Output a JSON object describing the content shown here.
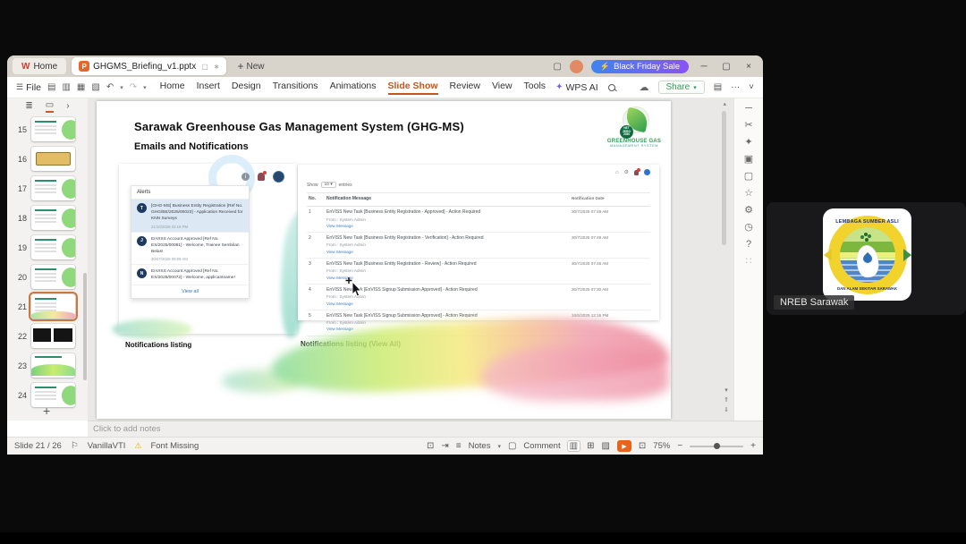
{
  "titlebar": {
    "home_tab": "Home",
    "doc_tab": "GHGMS_Briefing_v1.pptx",
    "new_label": "New",
    "promo_label": "Black Friday Sale"
  },
  "menubar": {
    "file_label": "File",
    "items": [
      "Home",
      "Insert",
      "Design",
      "Transitions",
      "Animations",
      "Slide Show",
      "Review",
      "View",
      "Tools"
    ],
    "active_item": "Slide Show",
    "wps_ai_label": "WPS AI",
    "share_label": "Share"
  },
  "thumbnails": {
    "slides": [
      {
        "num": "15",
        "variant": "green"
      },
      {
        "num": "16",
        "variant": "yellow"
      },
      {
        "num": "17",
        "variant": "green"
      },
      {
        "num": "18",
        "variant": "green"
      },
      {
        "num": "19",
        "variant": "green"
      },
      {
        "num": "20",
        "variant": "green"
      },
      {
        "num": "21",
        "variant": "pink",
        "selected": true
      },
      {
        "num": "22",
        "variant": "dark"
      },
      {
        "num": "23",
        "variant": "green2"
      },
      {
        "num": "24",
        "variant": "green"
      }
    ]
  },
  "slide": {
    "title": "Sarawak Greenhouse Gas Management System (GHG-MS)",
    "subtitle": "Emails and Notifications",
    "logo": {
      "badge_line1": "NET",
      "badge_line2": "ZERO",
      "badge_line3": "2050",
      "name_line1": "GREENHOUSE GAS",
      "name_line2": "MANAGEMENT SYSTEM"
    },
    "captions": {
      "left": "Notifications listing",
      "right": "Notifications listing (View All)"
    },
    "alerts": {
      "header": "Alerts",
      "view_all": "View all",
      "items": [
        {
          "avatar": "T",
          "text": "[GHG-MS] Business Entity Registration [Ref No. GHG/BE/2025/00023] - Application Received for KNN Surveys",
          "time": "21/10/2025 02:19 PM",
          "highlight": true
        },
        {
          "avatar": "J",
          "text": "EnVISS Account Approved [Ref No. ES/2025/00081] - Welcome, Trainee Sembilan Belas!",
          "time": "30/07/2025 09:09 AM",
          "highlight": false
        },
        {
          "avatar": "N",
          "text": "EnVISS Account Approved [Ref No. ES/2025/00072] - Welcome, applicantname!",
          "time": "",
          "highlight": false
        }
      ]
    },
    "portal": {
      "show_label": "Show",
      "show_value": "10",
      "entries_label": "entries",
      "headers": [
        "No.",
        "Notification Message",
        "Notification Date"
      ],
      "rows": [
        {
          "no": "1",
          "message": "EnVISS New Task [Business Entity Registration - Approved] - Action Required",
          "from": "From : System Admin",
          "link": "View Message",
          "date": "30/7/2025 07:49 AM"
        },
        {
          "no": "2",
          "message": "EnVISS New Task [Business Entity Registration - Verification] - Action Required",
          "from": "From : System Admin",
          "link": "View Message",
          "date": "30/7/2025 07:49 AM"
        },
        {
          "no": "3",
          "message": "EnVISS New Task [Business Entity Registration - Review] - Action Required",
          "from": "From : System Admin",
          "link": "View Message",
          "date": "30/7/2025 07:46 AM"
        },
        {
          "no": "4",
          "message": "EnVISS New Task [EnVISS Signup Submission Approved] - Action Required",
          "from": "From : System Admin",
          "link": "View Message",
          "date": "30/7/2025 07:30 AM"
        },
        {
          "no": "5",
          "message": "EnVISS New Task [EnVISS Signup Submission Approved] - Action Required",
          "from": "From : System Admin",
          "link": "View Message",
          "date": "16/6/2025 12:16 PM"
        }
      ]
    }
  },
  "notes_placeholder": "Click to add notes",
  "statusbar": {
    "slide_info": "Slide 21 / 26",
    "theme_name": "VanillaVTI",
    "font_warning": "Font Missing",
    "notes_label": "Notes",
    "comment_label": "Comment",
    "zoom_value": "75%"
  },
  "meeting": {
    "participant_name": "NREB Sarawak",
    "logo_text_top": "LEMBAGA SUMBER ASLI",
    "logo_text_bottom": "DAN ALAM SEKITAR SARAWAK"
  },
  "icons": {
    "hamburger": "☰",
    "save": "▤",
    "export": "▥",
    "print": "▦",
    "print_preview": "▧",
    "undo": "↶",
    "redo": "↷",
    "caret_down": "▾",
    "wps_ai": "✦",
    "cloud": "☁",
    "more": "···",
    "collapse": "˅",
    "split": "▢",
    "minimize": "─",
    "restore": "▢",
    "close": "×",
    "bolt": "⚡",
    "plus": "+",
    "outline_view": "≣",
    "slide_view": "▭",
    "chevron_right": "›",
    "scroll_up": "▴",
    "scroll_down": "▾",
    "prev_slide": "⇑",
    "next_slide": "⇓",
    "home": "⌂",
    "gear": "⚙",
    "bell": "🔔",
    "star": "☆",
    "scissors": "✂",
    "comment_bubble": "▢",
    "clock": "◷",
    "help": "?",
    "apps": "∷",
    "dash": "─",
    "sparkle": "✦",
    "shapes": "▣",
    "notes_lines": "≡",
    "jump": "⇥",
    "board": "▤",
    "view_normal": "▥",
    "view_sorter": "⊞",
    "view_read": "▨",
    "play": "▶",
    "fit": "⊡",
    "minus": "−",
    "theme": "⚐",
    "warning": "⚠",
    "info": "i",
    "sync": "▢",
    "pin": "∗"
  },
  "colors": {
    "accent_orange": "#c4551c",
    "promo_gradient_from": "#3f84f0",
    "promo_gradient_to": "#8a53f3",
    "play_button": "#e8631c",
    "share_green": "#2d9e57",
    "alert_highlight": "#dce8f3",
    "link_blue": "#3f7fc1"
  }
}
